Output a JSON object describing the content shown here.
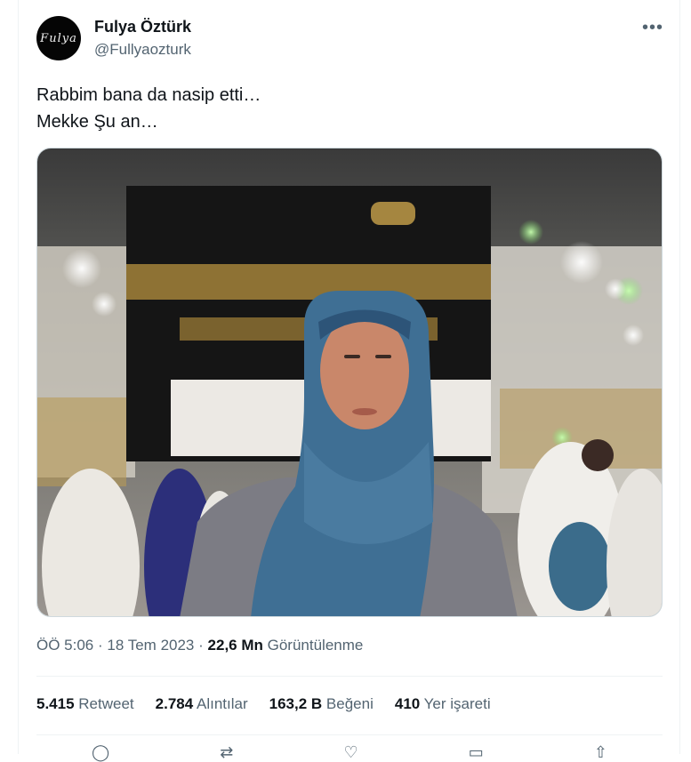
{
  "author": {
    "name": "Fulya Öztürk",
    "handle": "@Fullyaozturk",
    "avatar_text": "Fulya"
  },
  "more_icon": "more-horizontal-icon",
  "tweet": {
    "lines": [
      "Rabbim bana da nasip etti…",
      "Mekke Şu an…"
    ]
  },
  "meta": {
    "time": "ÖÖ 5:06",
    "sep1": "·",
    "date": "18 Tem 2023",
    "sep2": "·",
    "views_value": "22,6 Mn",
    "views_label": "Görüntülenme"
  },
  "stats": {
    "retweets": {
      "value": "5.415",
      "label": "Retweet"
    },
    "quotes": {
      "value": "2.784",
      "label": "Alıntılar"
    },
    "likes": {
      "value": "163,2 B",
      "label": "Beğeni"
    },
    "bookmarks": {
      "value": "410",
      "label": "Yer işareti"
    }
  },
  "actions": [
    "reply-icon",
    "retweet-icon",
    "like-icon",
    "bookmark-icon",
    "share-icon"
  ],
  "colors": {
    "text": "#0f1419",
    "secondary": "#536471",
    "divider": "#eff3f4"
  }
}
